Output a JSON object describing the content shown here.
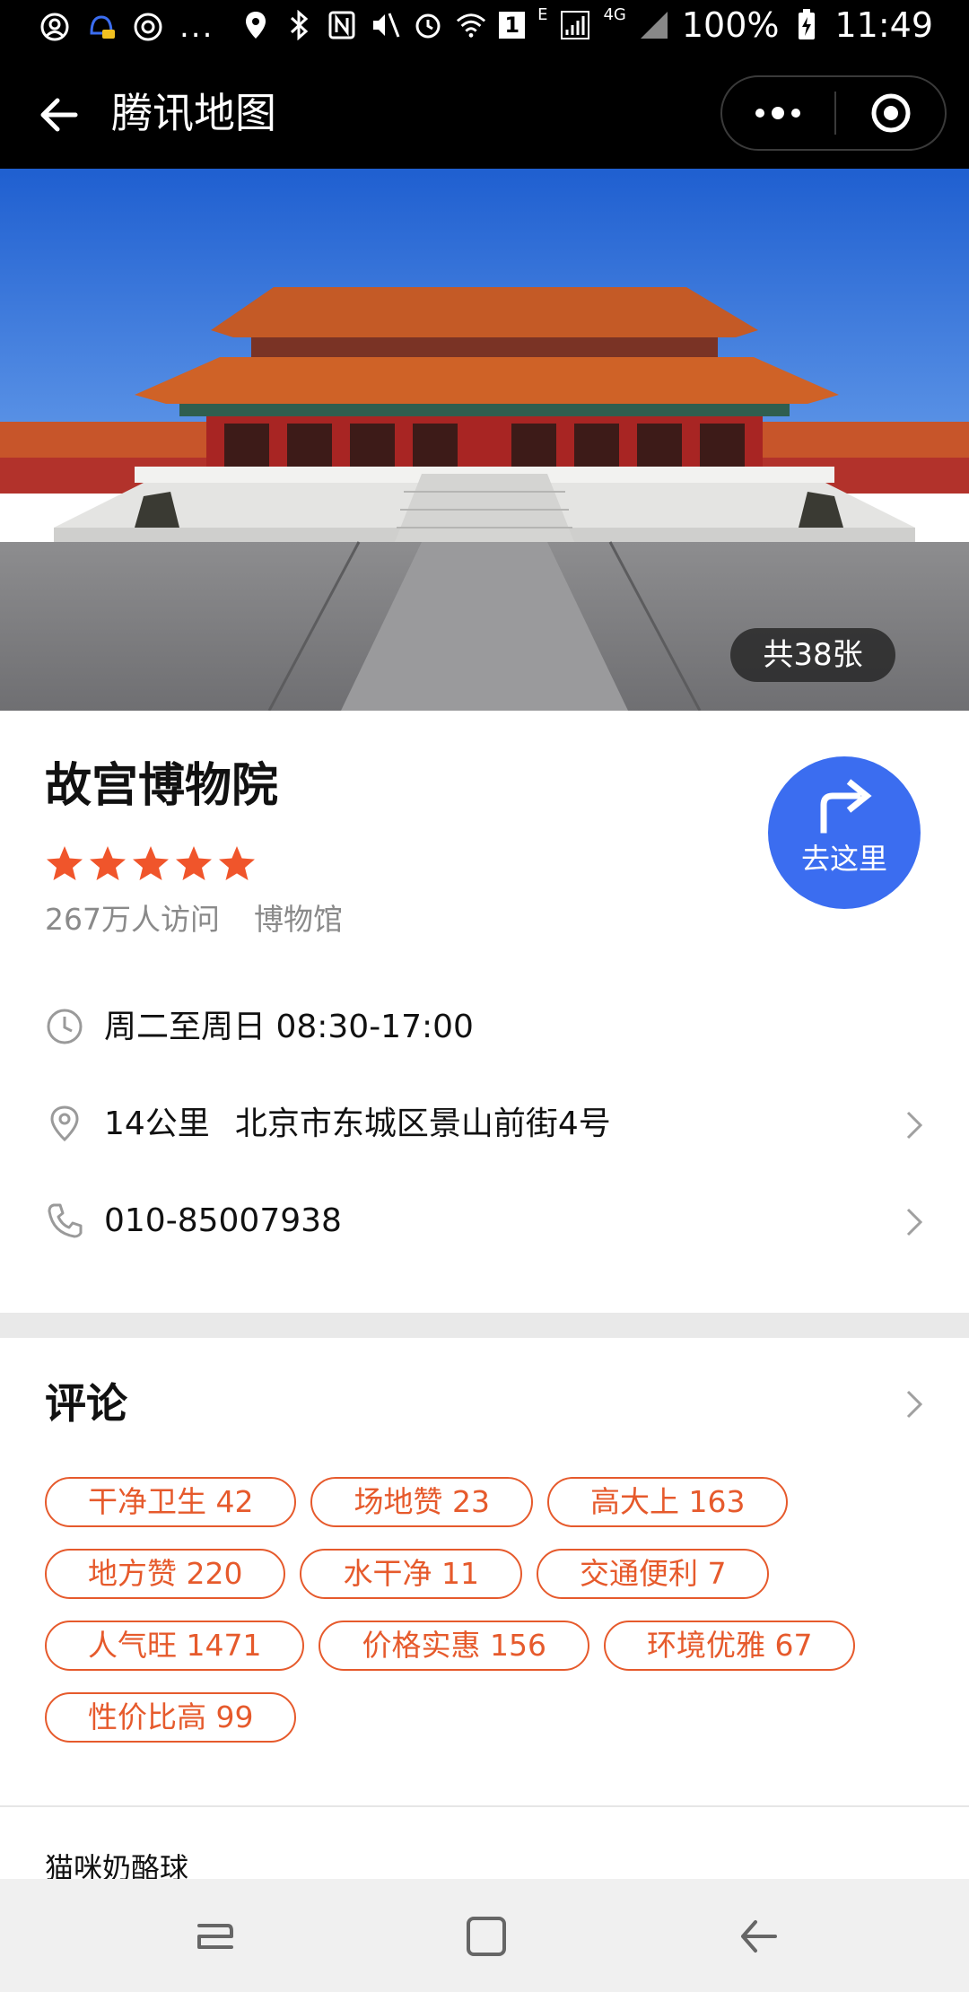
{
  "status_bar": {
    "battery": "100%",
    "time": "11:49",
    "network_type": "4G",
    "network_e": "E",
    "badge": "1",
    "more": "..."
  },
  "nav": {
    "title": "腾讯地图"
  },
  "hero": {
    "photo_count": "共38张"
  },
  "poi": {
    "name": "故宫博物院",
    "rating": 5,
    "visitors": "267万人访问",
    "category": "博物馆",
    "go_label": "去这里",
    "hours": "周二至周日 08:30-17:00",
    "distance": "14公里",
    "address": "北京市东城区景山前街4号",
    "phone": "010-85007938"
  },
  "comments": {
    "title": "评论",
    "tags": [
      [
        "干净卫生 42",
        "场地赞 23",
        "高大上 163"
      ],
      [
        "地方赞 220",
        "水干净 11",
        "交通便利 7"
      ],
      [
        "人气旺 1471",
        "价格实惠 156",
        "环境优雅 67"
      ],
      [
        "性价比高 99"
      ]
    ],
    "first_reviewer": "猫咪奶酪球"
  },
  "colors": {
    "accent_blue": "#3b6df0",
    "tag_orange": "#e65a2c",
    "star_orange": "#f0552b"
  }
}
